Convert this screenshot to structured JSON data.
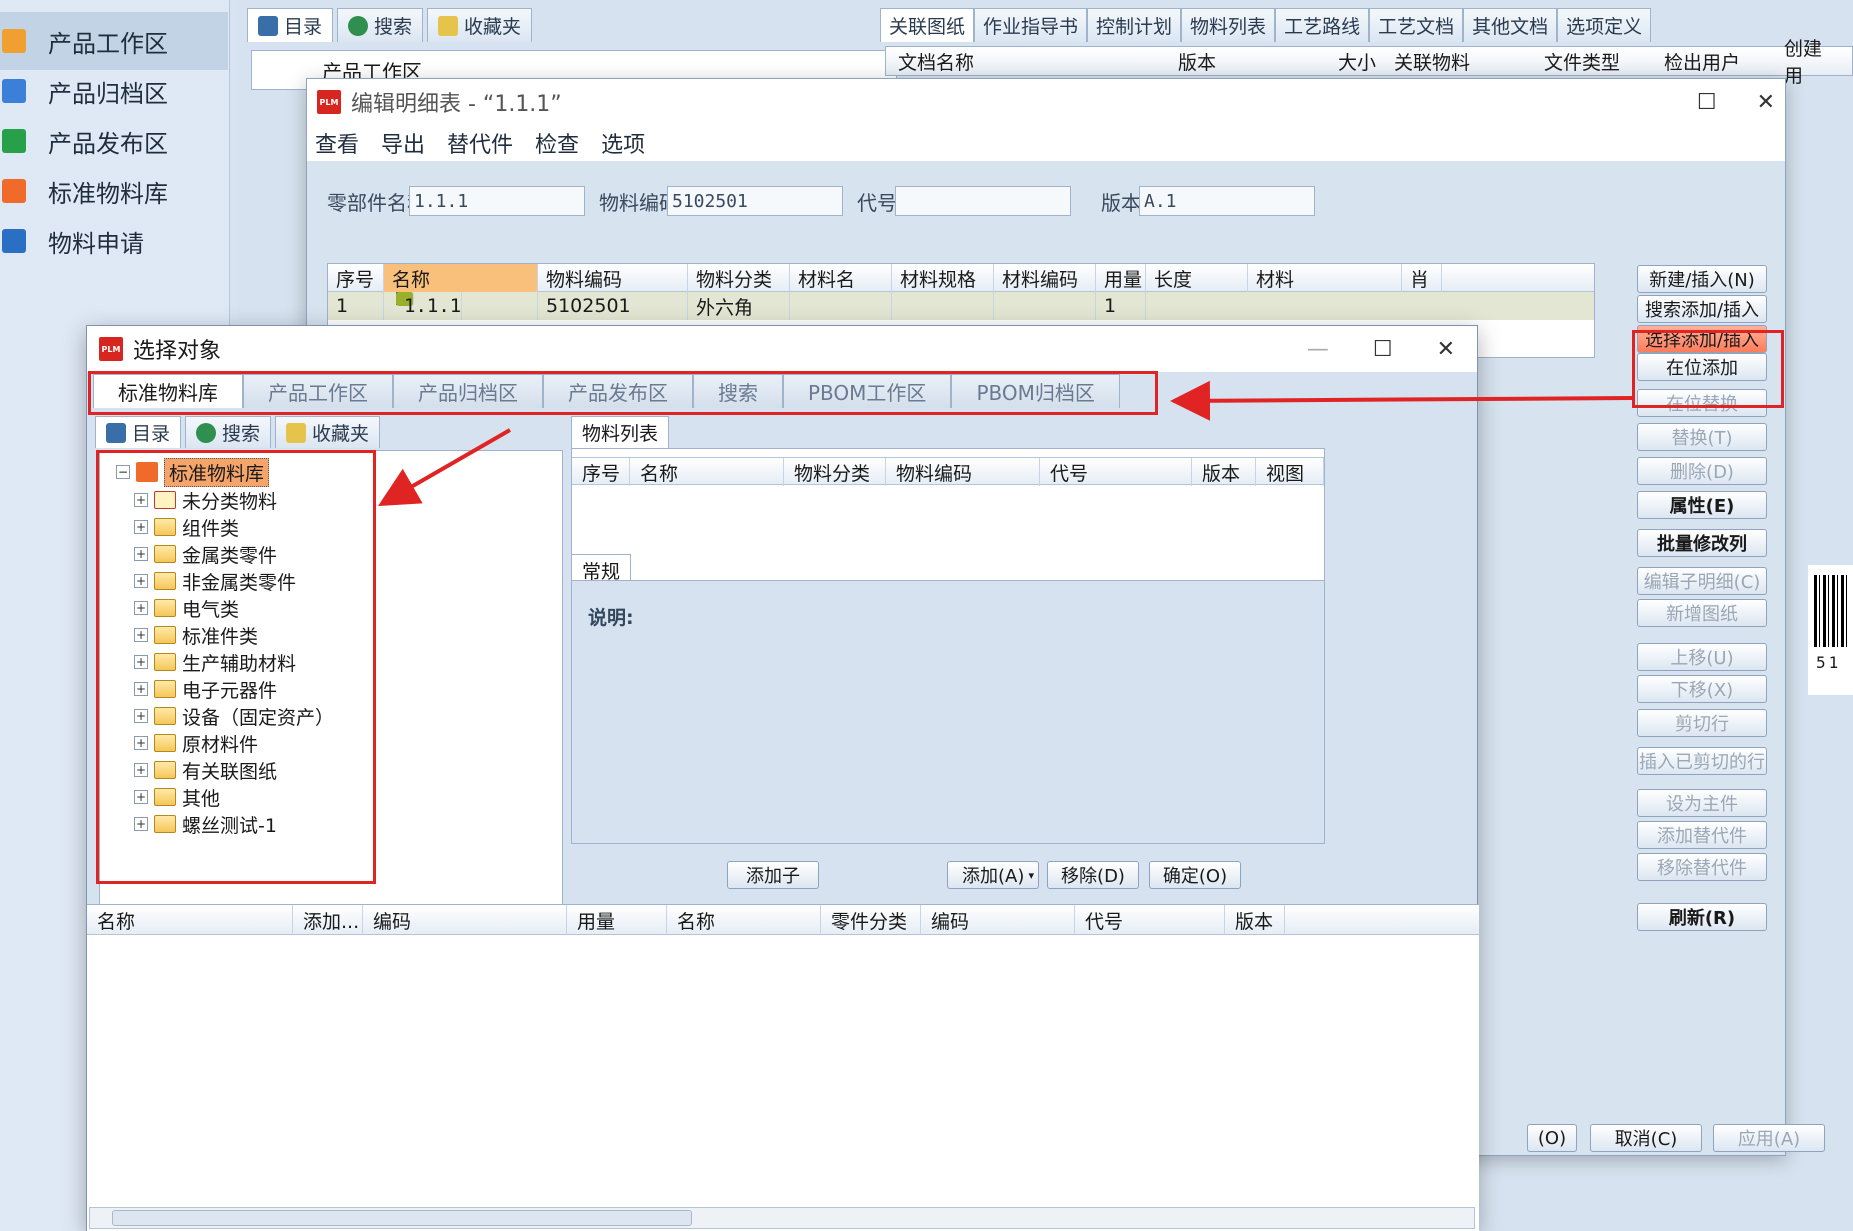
{
  "left_nav": {
    "items": [
      {
        "label": "产品工作区",
        "icon": "stack-icon",
        "color": "#f0a030",
        "active": true
      },
      {
        "label": "产品归档区",
        "icon": "archive-icon",
        "color": "#3c7fd8",
        "active": false
      },
      {
        "label": "产品发布区",
        "icon": "publish-icon",
        "color": "#27a04a",
        "active": false
      },
      {
        "label": "标准物料库",
        "icon": "library-icon",
        "color": "#f06a2a",
        "active": false
      },
      {
        "label": "物料申请",
        "icon": "request-icon",
        "color": "#2b6fc4",
        "active": false
      }
    ]
  },
  "background": {
    "left_tabs": [
      "目录",
      "搜索",
      "收藏夹"
    ],
    "tree_root": "产品工作区",
    "right_tabs": [
      "关联图纸",
      "作业指导书",
      "控制计划",
      "物料列表",
      "工艺路线",
      "工艺文档",
      "其他文档",
      "选项定义"
    ],
    "doc_columns": [
      "文档名称",
      "版本",
      "大小",
      "关联物料",
      "文件类型",
      "检出用户",
      "创建用"
    ]
  },
  "edit_window": {
    "title": "编辑明细表 - “1.1.1”",
    "menu": [
      "查看",
      "导出",
      "替代件",
      "检查",
      "选项"
    ],
    "fields": {
      "part_name_label": "零部件名称",
      "part_name": "1.1.1",
      "material_code_label": "物料编码",
      "material_code": "5102501",
      "code_label": "代号",
      "code": "",
      "version_label": "版本",
      "version": "A.1"
    },
    "table_columns": [
      "序号",
      "名称",
      "物料编码",
      "物料分类",
      "材料名",
      "材料规格",
      "材料编码",
      "用量",
      "长度",
      "材料",
      "肖"
    ],
    "row": {
      "index": "1",
      "name": "1.1.1",
      "material_code": "5102501",
      "category": "外六角",
      "qty": "1"
    },
    "side_buttons": [
      {
        "label": "新建/插入(N)",
        "state": "normal"
      },
      {
        "label": "搜索添加/插入",
        "state": "normal"
      },
      {
        "label": "选择添加/插入",
        "state": "highlight"
      },
      {
        "label": "在位添加",
        "state": "normal"
      },
      {
        "label": "在位替换",
        "state": "disabled"
      },
      {
        "label": "替换(T)",
        "state": "disabled"
      },
      {
        "label": "删除(D)",
        "state": "disabled"
      },
      {
        "label": "属性(E)",
        "state": "bold"
      },
      {
        "label": "批量修改列",
        "state": "bold"
      },
      {
        "label": "编辑子明细(C)",
        "state": "disabled"
      },
      {
        "label": "新增图纸",
        "state": "disabled"
      },
      {
        "label": "上移(U)",
        "state": "disabled"
      },
      {
        "label": "下移(X)",
        "state": "disabled"
      },
      {
        "label": "剪切行",
        "state": "disabled"
      },
      {
        "label": "插入已剪切的行",
        "state": "disabled"
      },
      {
        "label": "设为主件",
        "state": "disabled"
      },
      {
        "label": "添加替代件",
        "state": "disabled"
      },
      {
        "label": "移除替代件",
        "state": "disabled"
      },
      {
        "label": "刷新(R)",
        "state": "bold"
      }
    ],
    "bottom_buttons": [
      "(O)",
      "取消(C)",
      "应用(A)"
    ],
    "barcode_text": "51"
  },
  "select_dialog": {
    "title": "选择对象",
    "tabs": [
      "标准物料库",
      "产品工作区",
      "产品归档区",
      "产品发布区",
      "搜索",
      "PBOM工作区",
      "PBOM归档区"
    ],
    "sub_tabs": [
      "目录",
      "搜索",
      "收藏夹"
    ],
    "tree_root": "标准物料库",
    "tree_items": [
      "未分类物料",
      "组件类",
      "金属类零件",
      "非金属类零件",
      "电气类",
      "标准件类",
      "生产辅助材料",
      "电子元器件",
      "设备（固定资产）",
      "原材料件",
      "有关联图纸",
      "其他",
      "螺丝测试-1"
    ],
    "material_list_title": "物料列表",
    "material_columns": [
      "序号",
      "名称",
      "物料分类",
      "物料编码",
      "代号",
      "版本",
      "视图"
    ],
    "general_tab": "常规",
    "description_label": "说明:",
    "buttons": {
      "add_child": "添加子",
      "add": "添加(A)",
      "remove": "移除(D)",
      "confirm": "确定(O)"
    },
    "result_columns": [
      "名称",
      "添加...",
      "编码",
      "用量",
      "名称",
      "零件分类",
      "编码",
      "代号",
      "版本"
    ]
  },
  "colors": {
    "highlight": "#e02424",
    "accent": "#f9c07b"
  }
}
